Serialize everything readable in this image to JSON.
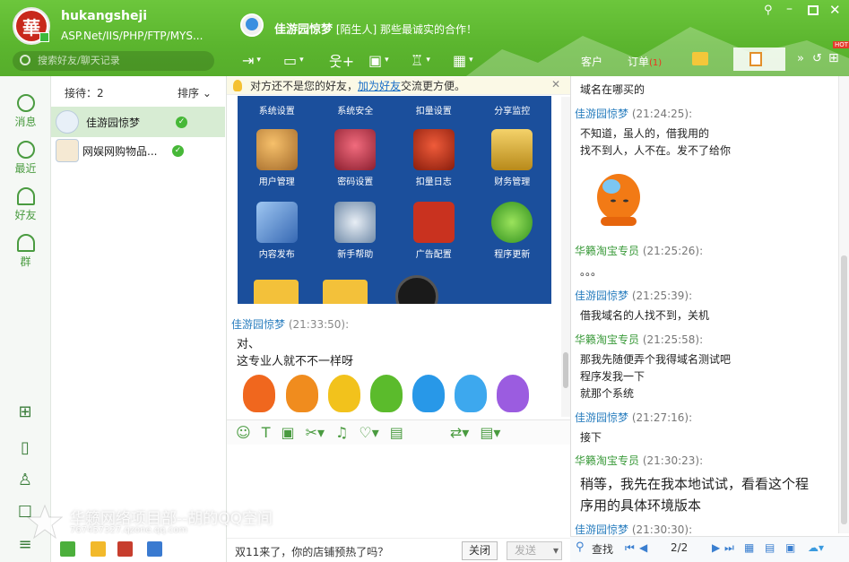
{
  "profile": {
    "avatar_text": "華",
    "username": "hukangsheji",
    "signature": "ASP.Net/IIS/PHP/FTP/MYS..."
  },
  "search": {
    "placeholder": "搜索好友/聊天记录"
  },
  "chat_header": {
    "name": "佳游园惊梦",
    "tag": "[陌生人]",
    "subtitle": "那些最诚实的合作！"
  },
  "header_tabs": {
    "customer": "客户",
    "orders": "订单",
    "orders_count": "(1)"
  },
  "nav": [
    {
      "label": "消息"
    },
    {
      "label": "最近"
    },
    {
      "label": "好友"
    },
    {
      "label": "群"
    }
  ],
  "contacts_header": {
    "reception": "接待：2",
    "sort": "排序"
  },
  "contacts": [
    {
      "name": "佳游园惊梦"
    },
    {
      "name": "网娱网购物品..."
    }
  ],
  "tip": {
    "text": "对方还不是您的好友，",
    "link": "加为好友",
    "suffix": "交流更方便。"
  },
  "shot": {
    "row1": [
      "系统设置",
      "系统安全",
      "扣量设置",
      "分享监控"
    ],
    "row2": [
      "用户管理",
      "密码设置",
      "扣量日志",
      "财务管理"
    ],
    "row3": [
      "内容发布",
      "新手帮助",
      "广告配置",
      "程序更新"
    ]
  },
  "chat": {
    "sender": "佳游园惊梦",
    "time": "(21:33:50):",
    "line1": "对、",
    "line2": "这专业人就不不一样呀"
  },
  "input_bar": {
    "promo": "双11来了，你的店铺预热了吗？",
    "close": "关闭",
    "send": "发送"
  },
  "history": [
    {
      "msg": "域名在哪买的"
    },
    {
      "name": "佳游园惊梦",
      "time": "(21:24:25):",
      "msg1": "不知道，虽人的，借我用的",
      "msg2": "找不到人，人不在。发不了给你"
    },
    {
      "name": "华籁淘宝专员",
      "time": "(21:25:26):",
      "msg1": "。。。"
    },
    {
      "name": "佳游园惊梦",
      "time": "(21:25:39):",
      "msg1": "借我域名的人找不到，关机"
    },
    {
      "name": "华籁淘宝专员",
      "time": "(21:25:58):",
      "msg1": "那我先随便弄个我得域名测试吧",
      "msg2": "程序发我一下",
      "msg3": "就那个系统"
    },
    {
      "name": "佳游园惊梦",
      "time": "(21:27:16):",
      "msg1": "接下"
    },
    {
      "name": "华籁淘宝专员",
      "time": "(21:30:23):",
      "msg1": "稍等，我先在我本地试试，看看这个程",
      "msg2": "序用的具体环境版本"
    },
    {
      "name": "佳游园惊梦",
      "time": "(21:30:30):"
    }
  ],
  "history_bar": {
    "find": "查找",
    "page": "2/2"
  },
  "watermark": {
    "line1": "华籁网络项目部--胡的QQ空间",
    "line2": "767457327.qzone.qq.com"
  },
  "colors": {
    "header": "#5bb52e",
    "accent": "#4a9b40",
    "link": "#2b7fbf"
  }
}
